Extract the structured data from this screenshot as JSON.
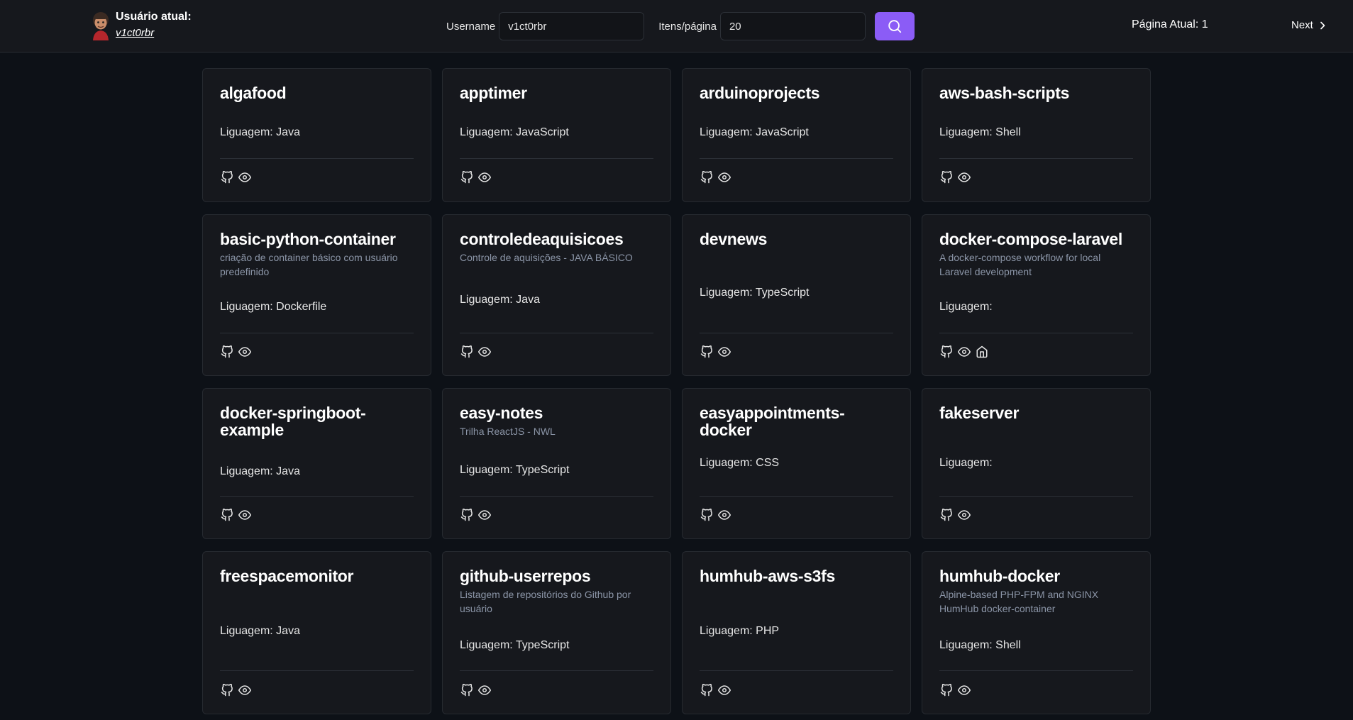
{
  "header": {
    "user_label": "Usuário atual:",
    "user_link": "v1ct0rbr",
    "username_label": "Username",
    "username_value": "v1ct0rbr",
    "items_label": "Itens/página",
    "items_value": "20",
    "page_indicator": "Página Atual: 1",
    "next_label": "Next",
    "accent_color": "#8b5cf6"
  },
  "repos": [
    {
      "name": "algafood",
      "description": "",
      "language": "Liguagem: Java",
      "icons": [
        "github-icon",
        "eye-icon"
      ]
    },
    {
      "name": "apptimer",
      "description": "",
      "language": "Liguagem: JavaScript",
      "icons": [
        "github-icon",
        "eye-icon"
      ]
    },
    {
      "name": "arduinoprojects",
      "description": "",
      "language": "Liguagem: JavaScript",
      "icons": [
        "github-icon",
        "eye-icon"
      ]
    },
    {
      "name": "aws-bash-scripts",
      "description": "",
      "language": "Liguagem: Shell",
      "icons": [
        "github-icon",
        "eye-icon"
      ]
    },
    {
      "name": "basic-python-container",
      "description": "criação de container básico com usuário predefinido",
      "language": "Liguagem: Dockerfile",
      "icons": [
        "github-icon",
        "eye-icon"
      ]
    },
    {
      "name": "controledeaquisicoes",
      "description": "Controle de aquisições - JAVA BÁSICO",
      "language": "Liguagem: Java",
      "icons": [
        "github-icon",
        "eye-icon"
      ]
    },
    {
      "name": "devnews",
      "description": "",
      "language": "Liguagem: TypeScript",
      "icons": [
        "github-icon",
        "eye-icon"
      ]
    },
    {
      "name": "docker-compose-laravel",
      "description": "A docker-compose workflow for local Laravel development",
      "language": "Liguagem:",
      "icons": [
        "github-icon",
        "eye-icon",
        "home-icon"
      ]
    },
    {
      "name": "docker-springboot-example",
      "description": "",
      "language": "Liguagem: Java",
      "icons": [
        "github-icon",
        "eye-icon"
      ]
    },
    {
      "name": "easy-notes",
      "description": "Trilha ReactJS - NWL",
      "language": "Liguagem: TypeScript",
      "icons": [
        "github-icon",
        "eye-icon"
      ]
    },
    {
      "name": "easyappointments-docker",
      "description": "",
      "language": "Liguagem: CSS",
      "icons": [
        "github-icon",
        "eye-icon"
      ]
    },
    {
      "name": "fakeserver",
      "description": "",
      "language": "Liguagem:",
      "icons": [
        "github-icon",
        "eye-icon"
      ]
    },
    {
      "name": "freespacemonitor",
      "description": "",
      "language": "Liguagem: Java",
      "icons": [
        "github-icon",
        "eye-icon"
      ]
    },
    {
      "name": "github-userrepos",
      "description": "Listagem de repositórios do Github por usuário",
      "language": "Liguagem: TypeScript",
      "icons": [
        "github-icon",
        "eye-icon"
      ]
    },
    {
      "name": "humhub-aws-s3fs",
      "description": "",
      "language": "Liguagem: PHP",
      "icons": [
        "github-icon",
        "eye-icon"
      ]
    },
    {
      "name": "humhub-docker",
      "description": "Alpine-based PHP-FPM and NGINX HumHub docker-container",
      "language": "Liguagem: Shell",
      "icons": [
        "github-icon",
        "eye-icon"
      ]
    }
  ]
}
